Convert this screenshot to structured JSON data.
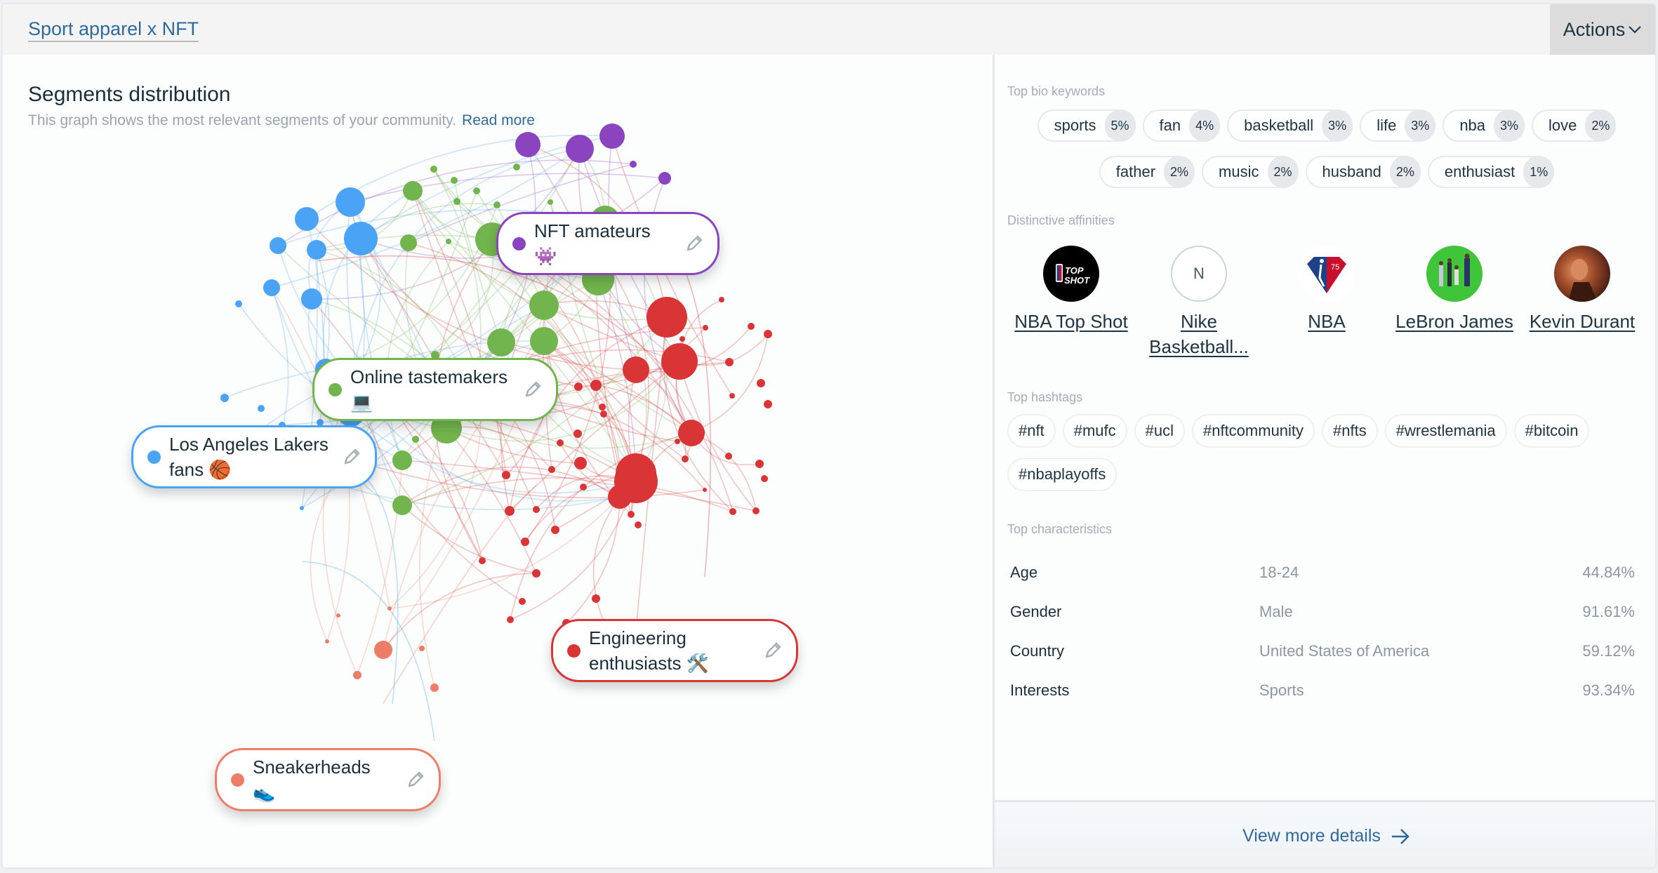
{
  "header": {
    "project_title": "Sport apparel x NFT",
    "actions_label": "Actions"
  },
  "segments_panel": {
    "title": "Segments distribution",
    "subtitle": "This graph shows the most relevant segments of your community.",
    "read_more": "Read more",
    "segments": [
      {
        "id": "nft",
        "name": "NFT amateurs",
        "emoji": "👾",
        "color": "#8a44c0"
      },
      {
        "id": "tastemakers",
        "name": "Online tastemakers",
        "emoji": "💻",
        "color": "#72b44d"
      },
      {
        "id": "lakers",
        "name": "Los Angeles Lakers fans",
        "emoji": "🏀",
        "color": "#4aa3f5"
      },
      {
        "id": "engineering",
        "name": "Engineering enthusiasts",
        "emoji": "🛠️",
        "color": "#d93536"
      },
      {
        "id": "sneakerheads",
        "name": "Sneakerheads",
        "emoji": "👟",
        "color": "#ee7d68"
      }
    ]
  },
  "right_panel": {
    "bio_keywords": {
      "heading": "Top bio keywords",
      "items": [
        {
          "word": "sports",
          "pct": "5%"
        },
        {
          "word": "fan",
          "pct": "4%"
        },
        {
          "word": "basketball",
          "pct": "3%"
        },
        {
          "word": "life",
          "pct": "3%"
        },
        {
          "word": "nba",
          "pct": "3%"
        },
        {
          "word": "love",
          "pct": "2%"
        },
        {
          "word": "father",
          "pct": "2%"
        },
        {
          "word": "music",
          "pct": "2%"
        },
        {
          "word": "husband",
          "pct": "2%"
        },
        {
          "word": "enthusiast",
          "pct": "1%"
        }
      ]
    },
    "affinities": {
      "heading": "Distinctive affinities",
      "items": [
        {
          "name": "NBA Top Shot",
          "avatar": "top-shot-logo"
        },
        {
          "name": "Nike Basketball...",
          "avatar": "initial-N",
          "initial": "N"
        },
        {
          "name": "NBA",
          "avatar": "nba-75-logo"
        },
        {
          "name": "LeBron James",
          "avatar": "photo"
        },
        {
          "name": "Kevin Durant",
          "avatar": "photo"
        }
      ]
    },
    "hashtags": {
      "heading": "Top hashtags",
      "items": [
        "#nft",
        "#mufc",
        "#ucl",
        "#nftcommunity",
        "#nfts",
        "#wrestlemania",
        "#bitcoin",
        "#nbaplayoffs"
      ]
    },
    "characteristics": {
      "heading": "Top characteristics",
      "rows": [
        {
          "label": "Age",
          "value": "18-24",
          "pct": "44.84%"
        },
        {
          "label": "Gender",
          "value": "Male",
          "pct": "91.61%"
        },
        {
          "label": "Country",
          "value": "United States of America",
          "pct": "59.12%"
        },
        {
          "label": "Interests",
          "value": "Sports",
          "pct": "93.34%"
        }
      ]
    },
    "view_more": "View more details"
  }
}
